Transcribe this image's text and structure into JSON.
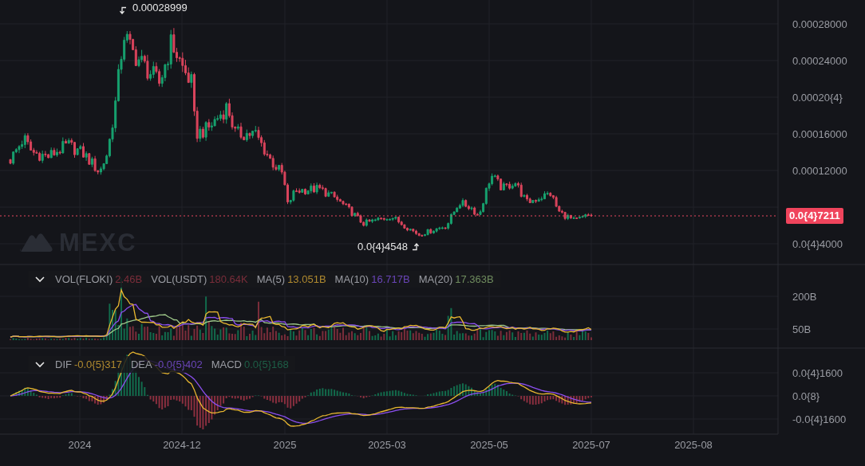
{
  "price_axis": {
    "ticks": [
      "0.00028000",
      "0.00024000",
      "0.00020{4}",
      "0.00016000",
      "0.00012000",
      "0.0{4}4000"
    ]
  },
  "current_price": {
    "label": "0.0{4}7211"
  },
  "high_marker": {
    "label": "0.00028999"
  },
  "low_marker": {
    "label": "0.0{4}4548"
  },
  "watermark": {
    "text": "MEXC"
  },
  "volume_pane": {
    "legend": [
      {
        "label": "VOL(FLOKI)",
        "value": "2.46B",
        "color": "#7a2d3a"
      },
      {
        "label": "VOL(USDT)",
        "value": "180.64K",
        "color": "#7a2d3a"
      },
      {
        "label": "MA(5)",
        "value": "13.051B",
        "color": "#b08a2f"
      },
      {
        "label": "MA(10)",
        "value": "16.717B",
        "color": "#6a45b8"
      },
      {
        "label": "MA(20)",
        "value": "17.363B",
        "color": "#6f8c5e"
      }
    ],
    "axis_ticks": [
      "200B",
      "50B"
    ]
  },
  "macd_pane": {
    "legend": [
      {
        "label": "DIF",
        "value": "-0.0{5}317",
        "color": "#b08a2f"
      },
      {
        "label": "DEA",
        "value": "-0.0{5}402",
        "color": "#6a45b8"
      },
      {
        "label": "MACD",
        "value": "0.0{5}168",
        "color": "#1d5e46"
      }
    ],
    "axis_ticks": [
      "0.0{4}1600",
      "0.0{8}",
      "-0.0{4}1600"
    ]
  },
  "time_axis": {
    "labels": [
      "2024",
      "2024-12",
      "2025",
      "2025-03",
      "2025-05",
      "2025-07",
      "2025-08"
    ]
  }
}
